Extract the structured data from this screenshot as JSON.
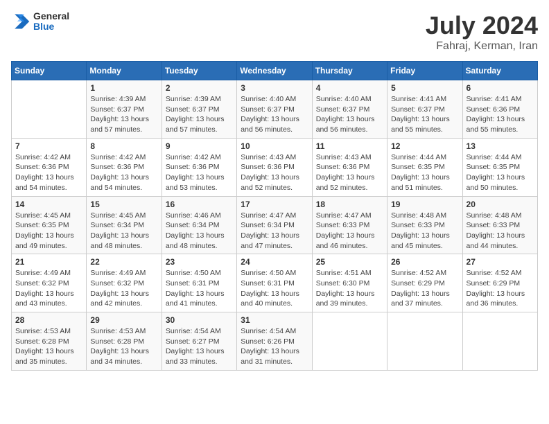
{
  "logo": {
    "general": "General",
    "blue": "Blue"
  },
  "header": {
    "title": "July 2024",
    "subtitle": "Fahraj, Kerman, Iran"
  },
  "weekdays": [
    "Sunday",
    "Monday",
    "Tuesday",
    "Wednesday",
    "Thursday",
    "Friday",
    "Saturday"
  ],
  "weeks": [
    [
      {
        "day": "",
        "info": ""
      },
      {
        "day": "1",
        "info": "Sunrise: 4:39 AM\nSunset: 6:37 PM\nDaylight: 13 hours\nand 57 minutes."
      },
      {
        "day": "2",
        "info": "Sunrise: 4:39 AM\nSunset: 6:37 PM\nDaylight: 13 hours\nand 57 minutes."
      },
      {
        "day": "3",
        "info": "Sunrise: 4:40 AM\nSunset: 6:37 PM\nDaylight: 13 hours\nand 56 minutes."
      },
      {
        "day": "4",
        "info": "Sunrise: 4:40 AM\nSunset: 6:37 PM\nDaylight: 13 hours\nand 56 minutes."
      },
      {
        "day": "5",
        "info": "Sunrise: 4:41 AM\nSunset: 6:37 PM\nDaylight: 13 hours\nand 55 minutes."
      },
      {
        "day": "6",
        "info": "Sunrise: 4:41 AM\nSunset: 6:36 PM\nDaylight: 13 hours\nand 55 minutes."
      }
    ],
    [
      {
        "day": "7",
        "info": "Sunrise: 4:42 AM\nSunset: 6:36 PM\nDaylight: 13 hours\nand 54 minutes."
      },
      {
        "day": "8",
        "info": "Sunrise: 4:42 AM\nSunset: 6:36 PM\nDaylight: 13 hours\nand 54 minutes."
      },
      {
        "day": "9",
        "info": "Sunrise: 4:42 AM\nSunset: 6:36 PM\nDaylight: 13 hours\nand 53 minutes."
      },
      {
        "day": "10",
        "info": "Sunrise: 4:43 AM\nSunset: 6:36 PM\nDaylight: 13 hours\nand 52 minutes."
      },
      {
        "day": "11",
        "info": "Sunrise: 4:43 AM\nSunset: 6:36 PM\nDaylight: 13 hours\nand 52 minutes."
      },
      {
        "day": "12",
        "info": "Sunrise: 4:44 AM\nSunset: 6:35 PM\nDaylight: 13 hours\nand 51 minutes."
      },
      {
        "day": "13",
        "info": "Sunrise: 4:44 AM\nSunset: 6:35 PM\nDaylight: 13 hours\nand 50 minutes."
      }
    ],
    [
      {
        "day": "14",
        "info": "Sunrise: 4:45 AM\nSunset: 6:35 PM\nDaylight: 13 hours\nand 49 minutes."
      },
      {
        "day": "15",
        "info": "Sunrise: 4:45 AM\nSunset: 6:34 PM\nDaylight: 13 hours\nand 48 minutes."
      },
      {
        "day": "16",
        "info": "Sunrise: 4:46 AM\nSunset: 6:34 PM\nDaylight: 13 hours\nand 48 minutes."
      },
      {
        "day": "17",
        "info": "Sunrise: 4:47 AM\nSunset: 6:34 PM\nDaylight: 13 hours\nand 47 minutes."
      },
      {
        "day": "18",
        "info": "Sunrise: 4:47 AM\nSunset: 6:33 PM\nDaylight: 13 hours\nand 46 minutes."
      },
      {
        "day": "19",
        "info": "Sunrise: 4:48 AM\nSunset: 6:33 PM\nDaylight: 13 hours\nand 45 minutes."
      },
      {
        "day": "20",
        "info": "Sunrise: 4:48 AM\nSunset: 6:33 PM\nDaylight: 13 hours\nand 44 minutes."
      }
    ],
    [
      {
        "day": "21",
        "info": "Sunrise: 4:49 AM\nSunset: 6:32 PM\nDaylight: 13 hours\nand 43 minutes."
      },
      {
        "day": "22",
        "info": "Sunrise: 4:49 AM\nSunset: 6:32 PM\nDaylight: 13 hours\nand 42 minutes."
      },
      {
        "day": "23",
        "info": "Sunrise: 4:50 AM\nSunset: 6:31 PM\nDaylight: 13 hours\nand 41 minutes."
      },
      {
        "day": "24",
        "info": "Sunrise: 4:50 AM\nSunset: 6:31 PM\nDaylight: 13 hours\nand 40 minutes."
      },
      {
        "day": "25",
        "info": "Sunrise: 4:51 AM\nSunset: 6:30 PM\nDaylight: 13 hours\nand 39 minutes."
      },
      {
        "day": "26",
        "info": "Sunrise: 4:52 AM\nSunset: 6:29 PM\nDaylight: 13 hours\nand 37 minutes."
      },
      {
        "day": "27",
        "info": "Sunrise: 4:52 AM\nSunset: 6:29 PM\nDaylight: 13 hours\nand 36 minutes."
      }
    ],
    [
      {
        "day": "28",
        "info": "Sunrise: 4:53 AM\nSunset: 6:28 PM\nDaylight: 13 hours\nand 35 minutes."
      },
      {
        "day": "29",
        "info": "Sunrise: 4:53 AM\nSunset: 6:28 PM\nDaylight: 13 hours\nand 34 minutes."
      },
      {
        "day": "30",
        "info": "Sunrise: 4:54 AM\nSunset: 6:27 PM\nDaylight: 13 hours\nand 33 minutes."
      },
      {
        "day": "31",
        "info": "Sunrise: 4:54 AM\nSunset: 6:26 PM\nDaylight: 13 hours\nand 31 minutes."
      },
      {
        "day": "",
        "info": ""
      },
      {
        "day": "",
        "info": ""
      },
      {
        "day": "",
        "info": ""
      }
    ]
  ]
}
